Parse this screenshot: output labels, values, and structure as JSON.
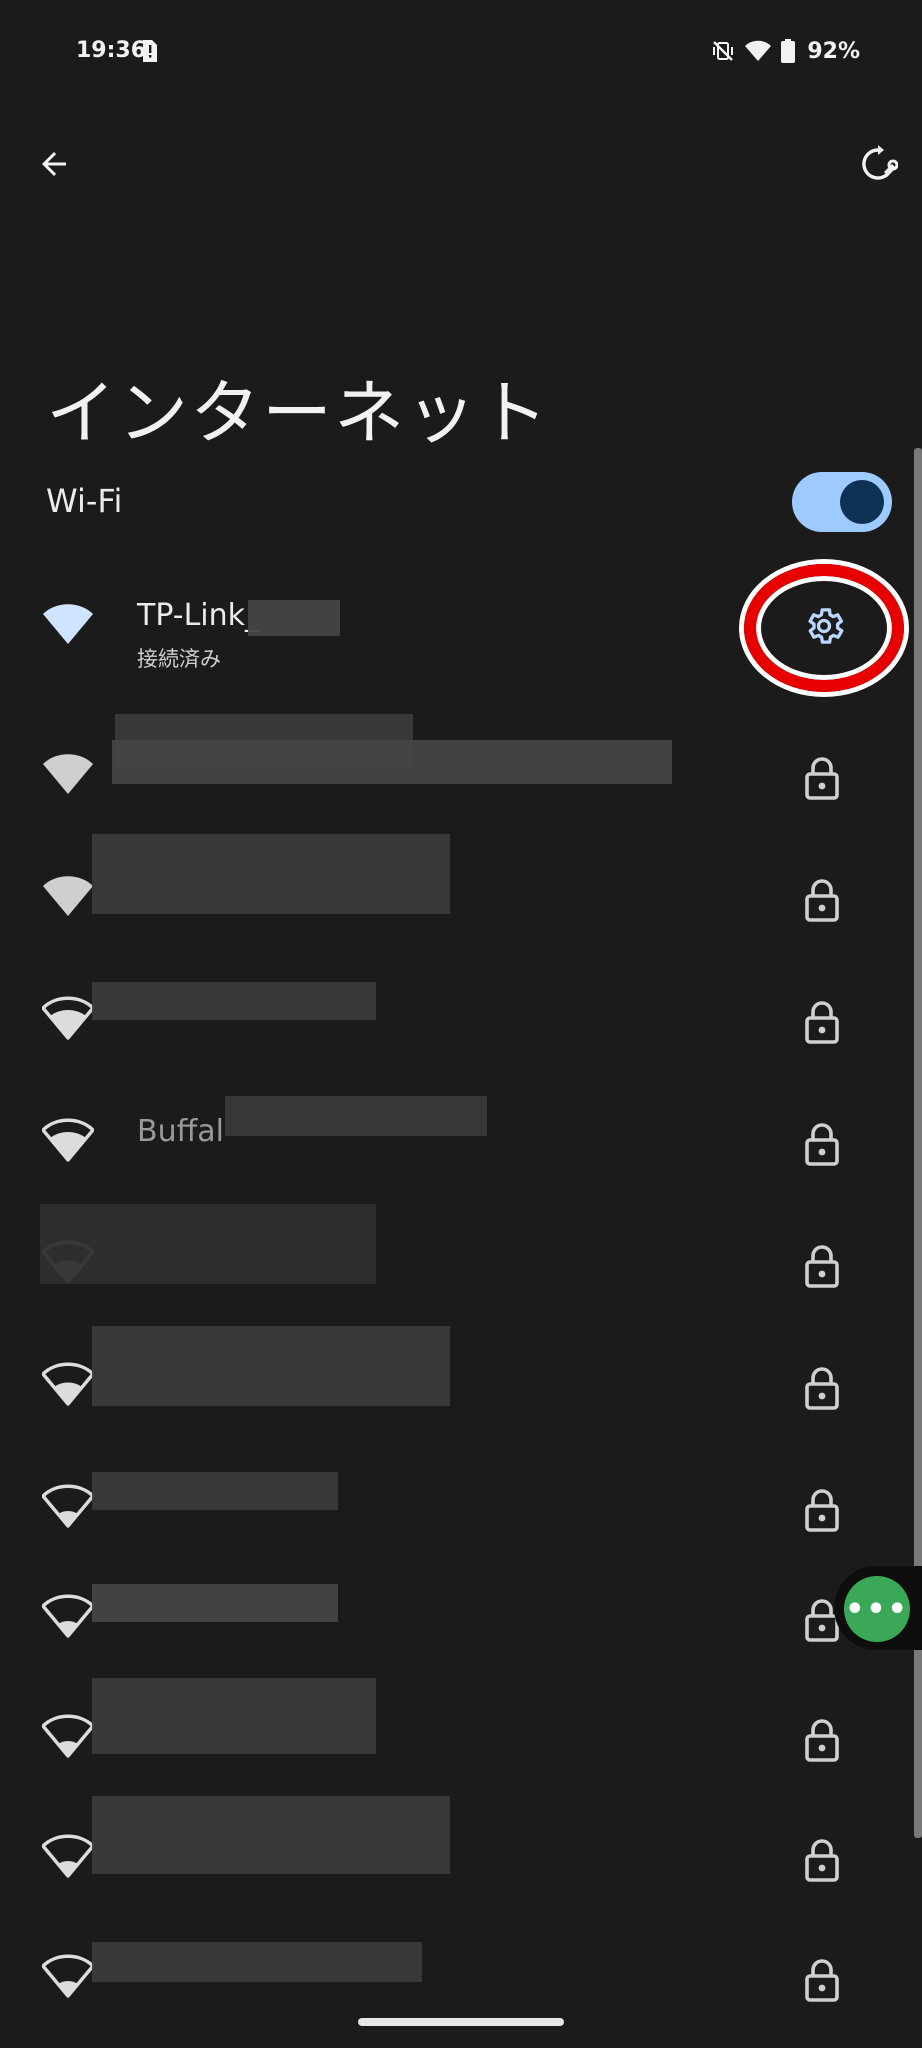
{
  "status_bar": {
    "time": "19:36",
    "battery": "92%",
    "icons": [
      "sim-alert-icon",
      "vibrate-off-icon",
      "wifi-icon",
      "battery-icon"
    ]
  },
  "top_bar": {
    "back_icon": "arrow-back-icon",
    "reset_icon": "network-reset-icon"
  },
  "page": {
    "title": "インターネット"
  },
  "wifi": {
    "label": "Wi-Fi",
    "enabled": true
  },
  "connected_network": {
    "name": "TP-Link_",
    "status": "接続済み",
    "settings_icon": "gear-icon"
  },
  "networks": [
    {
      "name": "",
      "locked": true
    },
    {
      "name": "",
      "locked": true
    },
    {
      "name": "",
      "locked": true
    },
    {
      "name": "Buffal",
      "locked": true
    },
    {
      "name": "",
      "locked": true
    },
    {
      "name": "",
      "locked": true
    },
    {
      "name": "",
      "locked": true
    },
    {
      "name": "",
      "locked": true
    },
    {
      "name": "",
      "locked": true
    },
    {
      "name": "",
      "locked": true
    },
    {
      "name": "",
      "locked": true
    }
  ],
  "floating_bubble": {
    "label": "•••"
  },
  "colors": {
    "background": "#1b1b1b",
    "toggle_track": "#9ecbff",
    "toggle_knob": "#0d3253",
    "connected_wifi": "#cfe4ff",
    "highlight_ring": "#e60000",
    "bubble": "#3aa856"
  }
}
